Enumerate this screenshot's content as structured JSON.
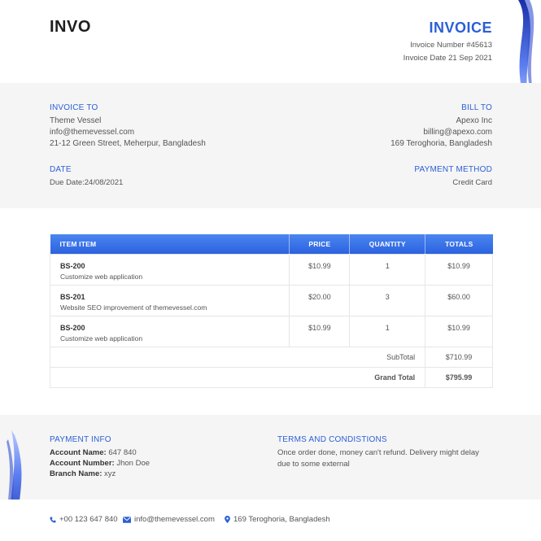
{
  "header": {
    "logo": "INVO",
    "title": "INVOICE",
    "invoice_number": "Invoice Number #45613",
    "invoice_date": "Invoice Date 21 Sep 2021"
  },
  "invoice_to": {
    "label": "INVOICE TO",
    "name": "Theme Vessel",
    "email": "info@themevessel.com",
    "address": "21-12 Green Street, Meherpur, Bangladesh"
  },
  "bill_to": {
    "label": "BILL TO",
    "name": "Apexo Inc",
    "email": "billing@apexo.com",
    "address": "169 Teroghoria, Bangladesh"
  },
  "date": {
    "label": "DATE",
    "value": "Due Date:24/08/2021"
  },
  "payment_method": {
    "label": "PAYMENT METHOD",
    "value": "Credit Card"
  },
  "table": {
    "headers": [
      "ITEM ITEM",
      "PRICE",
      "QUANTITY",
      "TOTALS"
    ],
    "rows": [
      {
        "code": "BS-200",
        "desc": "Customize web application",
        "price": "$10.99",
        "qty": "1",
        "total": "$10.99"
      },
      {
        "code": "BS-201",
        "desc": "Website SEO improvement of themevessel.com",
        "price": "$20.00",
        "qty": "3",
        "total": "$60.00"
      },
      {
        "code": "BS-200",
        "desc": "Customize web application",
        "price": "$10.99",
        "qty": "1",
        "total": "$10.99"
      }
    ],
    "subtotal_label": "SubTotal",
    "subtotal_value": "$710.99",
    "grand_label": "Grand Total",
    "grand_value": "$795.99"
  },
  "payment_info": {
    "label": "PAYMENT INFO",
    "account_name_label": "Account Name:",
    "account_name": " 647 840",
    "account_number_label": "Account Number:",
    "account_number": " Jhon Doe",
    "branch_name_label": "Branch Name:",
    "branch_name": " xyz"
  },
  "terms": {
    "label": "TERMS AND CONDISTIONS",
    "text": "Once order done, money can't refund. Delivery might delay due to some external"
  },
  "footer": {
    "phone": "+00 123 647 840",
    "email": "info@themevessel.com",
    "address": "169 Teroghoria, Bangladesh",
    "icons": [
      "phone-icon",
      "mail-icon",
      "location-pin-icon"
    ]
  },
  "colors": {
    "accent": "#2b5fd6",
    "band": "#f5f5f5"
  }
}
